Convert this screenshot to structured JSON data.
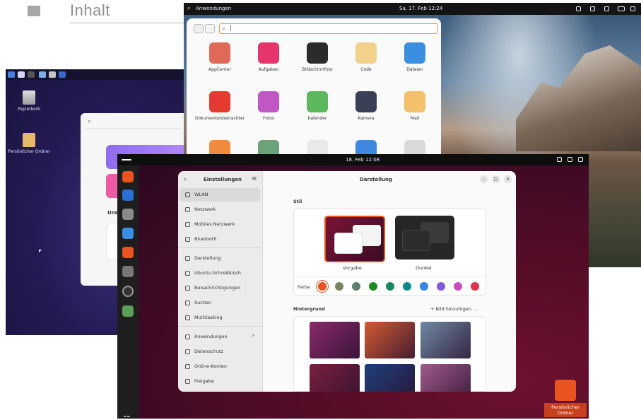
{
  "header": {
    "title": "Inhalt"
  },
  "xfce": {
    "desktop_icons": [
      "Papierkorb",
      "Persönlicher Ordner"
    ],
    "section_label": "Uns"
  },
  "gnome": {
    "topbar": {
      "activities": "Anwendungen",
      "datetime": "Sa, 17. Feb  12:24"
    },
    "search_value": "|",
    "apps": [
      {
        "label": "AppCenter",
        "color": "#e06a5a"
      },
      {
        "label": "Aufgaben",
        "color": "#e5356b"
      },
      {
        "label": "Bildschirmfoto",
        "color": "#2b2b2b"
      },
      {
        "label": "Code",
        "color": "#f2d28b"
      },
      {
        "label": "Dateien",
        "color": "#3b8fe0"
      },
      {
        "label": "Dokumentenbetrachter",
        "color": "#e53a2f"
      },
      {
        "label": "Fotos",
        "color": "#c057c4"
      },
      {
        "label": "Kalender",
        "color": "#5bb85d"
      },
      {
        "label": "Kamera",
        "color": "#3b3f55"
      },
      {
        "label": "Mail",
        "color": "#f4c06a"
      },
      {
        "label": "",
        "color": "#f08a3e"
      },
      {
        "label": "",
        "color": "#6da37a"
      },
      {
        "label": "",
        "color": "#e9e9e9"
      },
      {
        "label": "",
        "color": "#3f88e0"
      },
      {
        "label": "",
        "color": "#dadada"
      }
    ]
  },
  "ubuntu": {
    "topbar_date": "18. Feb  12:08",
    "dock_colors": [
      "#e95420",
      "#2a6fd6",
      "#8a8a8a",
      "#3a8ee6",
      "#e95420",
      "#777777",
      "#333333",
      "#5aa05a"
    ],
    "settings": {
      "sidebar_title": "Einstellungen",
      "items": [
        {
          "label": "WLAN",
          "selected": true
        },
        {
          "label": "Netzwerk"
        },
        {
          "label": "Mobiles Netzwerk"
        },
        {
          "label": "Bluetooth"
        },
        {
          "label": "Darstellung"
        },
        {
          "label": "Ubuntu-Schreibtisch"
        },
        {
          "label": "Benachrichtigungen"
        },
        {
          "label": "Suchen"
        },
        {
          "label": "Multitasking"
        },
        {
          "label": "Anwendungen"
        },
        {
          "label": "Datenschutz"
        },
        {
          "label": "Online-Konten"
        },
        {
          "label": "Freigabe"
        }
      ],
      "page_title": "Darstellung",
      "style_section": "Stil",
      "style_default": "Vorgabe",
      "style_dark": "Dunkel",
      "color_label": "Farbe",
      "accent_colors": [
        "#e95420",
        "#788361",
        "#5f7f6d",
        "#1c8a1c",
        "#17885f",
        "#0a8a8c",
        "#3584e4",
        "#7f5bdb",
        "#c44fb8",
        "#e0314b"
      ],
      "background_section": "Hintergrund",
      "add_background": "+ Bild hinzufügen ...",
      "wallpapers": [
        "#8a2a6a",
        "#d35a32",
        "#6f8aa3",
        "#7a1f3e",
        "#1f3f7a",
        "#a05a8a"
      ]
    },
    "home_folder": "Persönlicher Ordner"
  }
}
